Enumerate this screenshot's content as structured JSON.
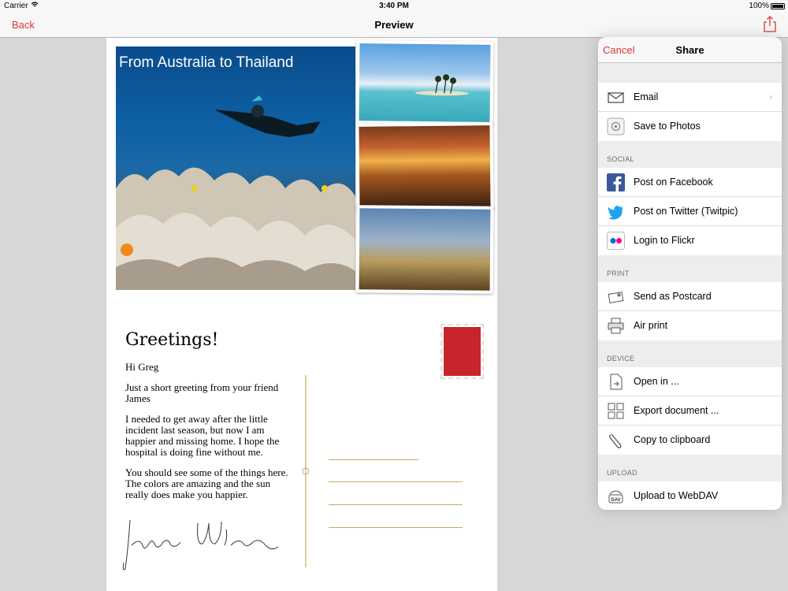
{
  "status_bar": {
    "carrier": "Carrier",
    "time": "3:40 PM",
    "battery": "100%"
  },
  "nav_bar": {
    "back": "Back",
    "title": "Preview"
  },
  "postcard": {
    "photo_caption": "From Australia to Thailand",
    "greeting_title": "Greetings!",
    "paragraphs": [
      "Hi Greg",
      "Just a short greeting from your friend James",
      "I needed to get away after the little incident last season, but now I am happier and missing home. I hope the hospital is doing fine without me.",
      "You should see some of the things here. The colors are amazing and the sun really does make you happier."
    ],
    "signature": "James Wilson"
  },
  "share": {
    "cancel": "Cancel",
    "title": "Share",
    "groups": [
      {
        "label": "",
        "rows": [
          {
            "label": "Email",
            "icon": "envelope-icon",
            "chevron": true
          },
          {
            "label": "Save to Photos",
            "icon": "photos-icon"
          }
        ]
      },
      {
        "label": "SOCIAL",
        "rows": [
          {
            "label": "Post on Facebook",
            "icon": "facebook-icon"
          },
          {
            "label": "Post on Twitter (Twitpic)",
            "icon": "twitter-icon"
          },
          {
            "label": "Login to Flickr",
            "icon": "flickr-icon"
          }
        ]
      },
      {
        "label": "PRINT",
        "rows": [
          {
            "label": "Send as Postcard",
            "icon": "postcard-icon"
          },
          {
            "label": "Air print",
            "icon": "printer-icon"
          }
        ]
      },
      {
        "label": "DEVICE",
        "rows": [
          {
            "label": "Open in ...",
            "icon": "open-in-icon"
          },
          {
            "label": "Export document ...",
            "icon": "export-icon"
          },
          {
            "label": "Copy to clipboard",
            "icon": "clipboard-icon"
          }
        ]
      },
      {
        "label": "UPLOAD",
        "rows": [
          {
            "label": "Upload to WebDAV",
            "icon": "webdav-icon"
          }
        ]
      }
    ]
  },
  "colors": {
    "accent": "#e0353a",
    "facebook": "#3b5998",
    "twitter": "#1da1f2"
  }
}
